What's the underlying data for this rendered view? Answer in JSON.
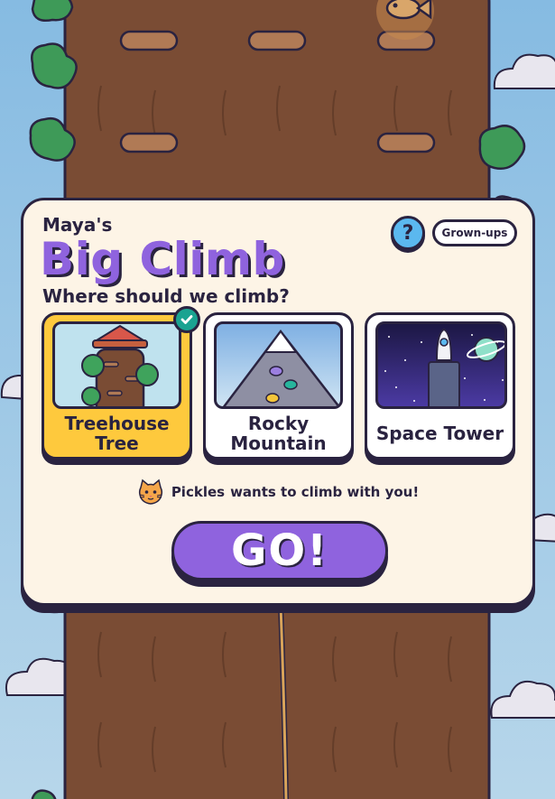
{
  "header": {
    "player_name": "Maya's",
    "title": "Big Climb",
    "help_label": "?",
    "grownups_label": "Grown-ups"
  },
  "prompt": "Where should we climb?",
  "climbs": [
    {
      "label_line1": "Treehouse",
      "label_line2": "Tree",
      "selected": true
    },
    {
      "label_line1": "Rocky",
      "label_line2": "Mountain",
      "selected": false
    },
    {
      "label_line1": "Space Tower",
      "selected": false
    }
  ],
  "buddy": {
    "name": "Pickles",
    "message": "wants to climb with you!",
    "icon": "cat-face-icon"
  },
  "go_label": "GO!",
  "colors": {
    "accent": "#8f63de",
    "selected_card": "#fec93d",
    "check": "#1aa391",
    "outline": "#2a2340",
    "panel": "#fdf4e6",
    "trunk": "#7a4c34",
    "sky": "#8fc0e3"
  }
}
